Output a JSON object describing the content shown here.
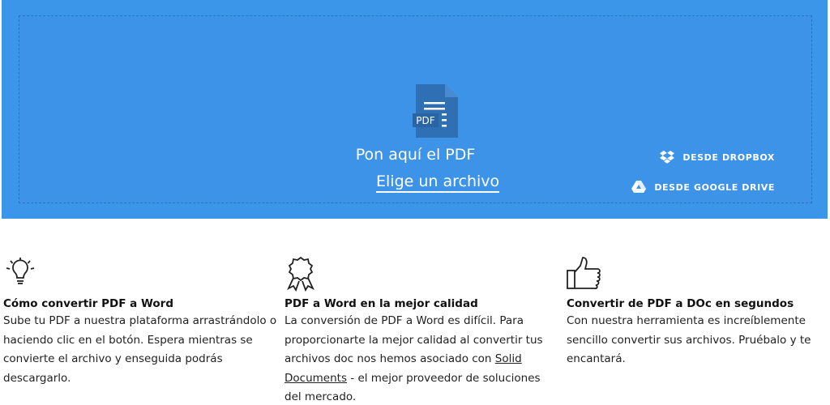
{
  "upload": {
    "file_icon": "pdf-file-icon",
    "file_badge": "PDF",
    "title": "Pon aquí el PDF",
    "choose_label": "Elige un archivo",
    "dropbox_label": "DESDE DROPBOX",
    "gdrive_label": "DESDE GOOGLE DRIVE",
    "colors": {
      "panel": "#3b96ea",
      "border": "#2a73c0",
      "icon": "#2f6fb3"
    }
  },
  "features": [
    {
      "icon": "lightbulb-icon",
      "title": "Cómo convertir PDF a Word",
      "text": "Sube tu PDF a nuestra plataforma arrastrándolo o haciendo clic en el botón. Espera mientras se convierte el archivo y enseguida podrás descargarlo."
    },
    {
      "icon": "award-ribbon-icon",
      "title": "PDF a Word en la mejor calidad",
      "text_before": "La conversión de PDF a Word es difícil. Para proporcionarte la mejor calidad al convertir tus archivos doc nos hemos asociado con",
      "link": "Solid Documents",
      "text_after": " - el mejor proveedor de soluciones del mercado."
    },
    {
      "icon": "thumbs-up-icon",
      "title": "Convertir de PDF a DOc en segundos",
      "text": "Con nuestra herramienta es increíblemente sencillo convertir sus archivos. Pruébalo y te encantará."
    }
  ]
}
